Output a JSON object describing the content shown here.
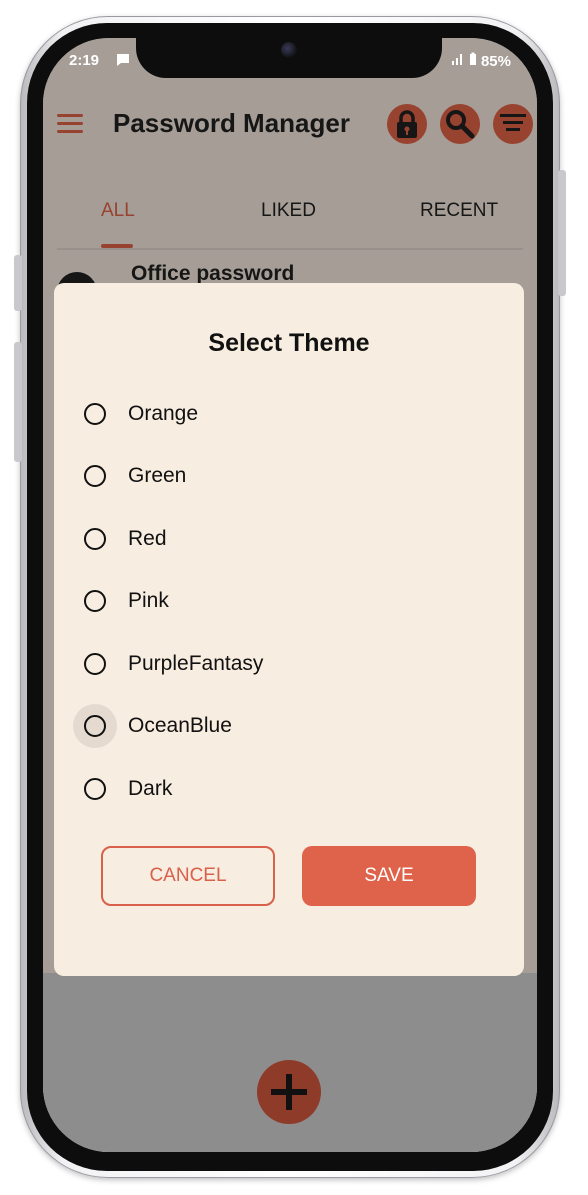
{
  "status_bar": {
    "time": "2:19",
    "battery": "85%"
  },
  "app": {
    "title": "Password Manager",
    "tabs": [
      {
        "label": "ALL",
        "active": true
      },
      {
        "label": "LIKED",
        "active": false
      },
      {
        "label": "RECENT",
        "active": false
      }
    ],
    "list_items": [
      {
        "title": "Office password"
      }
    ],
    "accent_color": "#b84a33"
  },
  "dialog": {
    "title": "Select Theme",
    "options": [
      {
        "label": "Orange"
      },
      {
        "label": "Green"
      },
      {
        "label": "Red"
      },
      {
        "label": "Pink"
      },
      {
        "label": "PurpleFantasy"
      },
      {
        "label": "OceanBlue"
      },
      {
        "label": "Dark"
      }
    ],
    "cancel_label": "CANCEL",
    "save_label": "SAVE"
  }
}
